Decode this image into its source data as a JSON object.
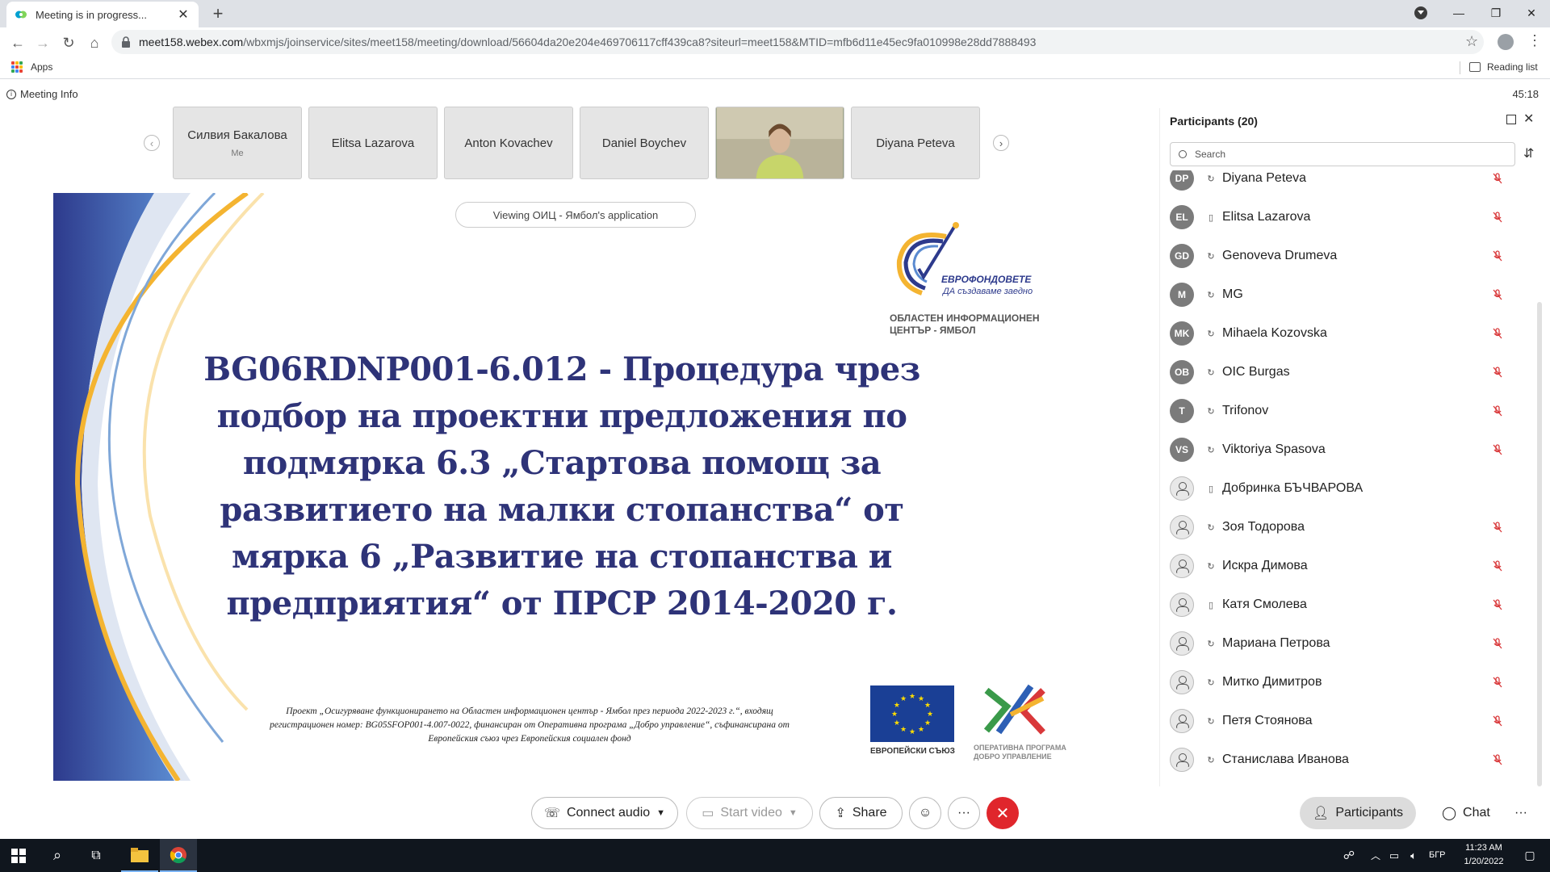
{
  "browser": {
    "tab_title": "Meeting is in progress...",
    "url_host": "meet158.webex.com",
    "url_rest": "/wbxmjs/joinservice/sites/meet158/meeting/download/56604da20e204e469706117cff439ca8?siteurl=meet158&MTID=mfb6d11e45ec9fa010998e28dd7888493",
    "bookmarks_apps": "Apps",
    "reading_list": "Reading list"
  },
  "meeting": {
    "info_label": "Meeting Info",
    "timer": "45:18",
    "viewing": "Viewing ОИЦ - Ямбол's application",
    "thumbnails": [
      {
        "name": "Силвия Бакалова",
        "sub": "Me"
      },
      {
        "name": "Elitsa Lazarova",
        "sub": ""
      },
      {
        "name": "Anton Kovachev",
        "sub": ""
      },
      {
        "name": "Daniel Boychev",
        "sub": ""
      },
      {
        "name": "",
        "sub": ""
      },
      {
        "name": "Diyana Peteva",
        "sub": ""
      }
    ]
  },
  "slide": {
    "title_lines": [
      "BG06RDNP001-6.012 - Процедура чрез",
      "подбор на проектни предложения по",
      "подмярка 6.3 „Стартова помощ за",
      "развитието на малки стопанства“ от",
      "мярка 6 „Развитие на стопанства и",
      "предприятия“ от ПРСР 2014-2020 г."
    ],
    "logo_brand": "ЕВРОФОНДОВЕТЕ",
    "logo_tagline": "ДА създаваме заедно",
    "logo_org_line1": "ОБЛАСТЕН ИНФОРМАЦИОНЕН",
    "logo_org_line2": "ЦЕНТЪР - ЯМБОЛ",
    "footnote_lines": [
      "Проект „Осигуряване функционирането на Областен информационен център - Ямбол през периода 2022-2023 г.“, входящ",
      "регистрационен номер: BG05SFOP001-4.007-0022, финансиран от Оперативна програма „Добро управление“, съфинансирана от",
      "Европейския съюз чрез Европейския социален фонд"
    ],
    "eu_caption": "ЕВРОПЕЙСКИ СЪЮЗ",
    "op_caption_line1": "ОПЕРАТИВНА ПРОГРАМА",
    "op_caption_line2": "ДОБРО УПРАВЛЕНИЕ"
  },
  "participants_panel": {
    "title": "Participants (20)",
    "search_placeholder": "Search",
    "list": [
      {
        "initials": "DP",
        "name": "Diyana Peteva",
        "device": "web",
        "muted": true
      },
      {
        "initials": "EL",
        "name": "Elitsa Lazarova",
        "device": "mobile",
        "muted": true
      },
      {
        "initials": "GD",
        "name": "Genoveva Drumeva",
        "device": "web",
        "muted": true
      },
      {
        "initials": "M",
        "name": "MG",
        "device": "web",
        "muted": true
      },
      {
        "initials": "MK",
        "name": "Mihaela Kozovska",
        "device": "web",
        "muted": true
      },
      {
        "initials": "OB",
        "name": "OIC Burgas",
        "device": "web",
        "muted": true
      },
      {
        "initials": "T",
        "name": "Trifonov",
        "device": "web",
        "muted": true
      },
      {
        "initials": "VS",
        "name": "Viktoriya Spasova",
        "device": "web",
        "muted": true
      },
      {
        "initials": "",
        "name": "Добринка БЪЧВАРОВА",
        "device": "mobile",
        "muted": false
      },
      {
        "initials": "",
        "name": "Зоя Тодорова",
        "device": "web",
        "muted": true
      },
      {
        "initials": "",
        "name": "Искра Димова",
        "device": "web",
        "muted": true
      },
      {
        "initials": "",
        "name": "Катя Смолева",
        "device": "mobile",
        "muted": true
      },
      {
        "initials": "",
        "name": "Мариана Петрова",
        "device": "web",
        "muted": true
      },
      {
        "initials": "",
        "name": "Митко Димитров",
        "device": "web",
        "muted": true
      },
      {
        "initials": "",
        "name": "Петя Стоянова",
        "device": "web",
        "muted": true
      },
      {
        "initials": "",
        "name": "Станислава Иванова",
        "device": "web",
        "muted": true
      }
    ]
  },
  "controls": {
    "connect_audio": "Connect audio",
    "start_video": "Start video",
    "share": "Share",
    "more": "···",
    "participants": "Participants",
    "chat": "Chat",
    "more2": "···"
  },
  "taskbar": {
    "language": "БГР",
    "time": "11:23 AM",
    "date": "1/20/2022"
  },
  "colors": {
    "slide_title": "#2e3378",
    "end_button": "#e0262c",
    "eu_blue": "#1a3f95",
    "eu_star": "#ffdd00",
    "mute_red": "#d9383a"
  }
}
